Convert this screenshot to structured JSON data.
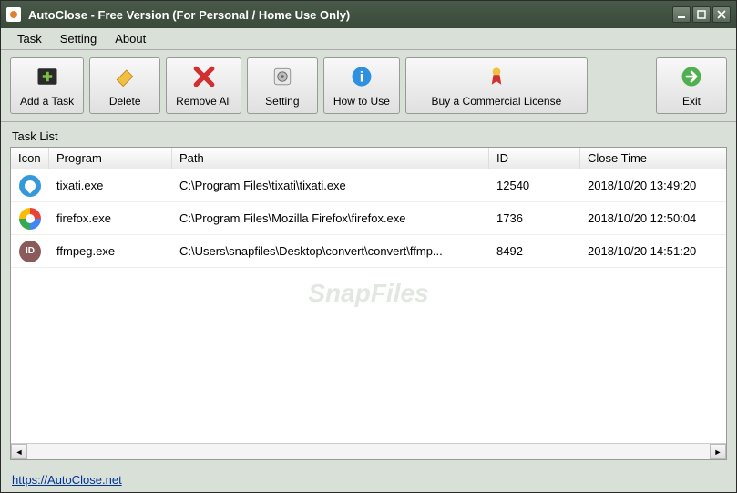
{
  "window": {
    "title": "AutoClose - Free Version (For Personal / Home Use Only)"
  },
  "menu": {
    "task": "Task",
    "setting": "Setting",
    "about": "About"
  },
  "toolbar": {
    "add": "Add a Task",
    "delete": "Delete",
    "removeAll": "Remove All",
    "setting": "Setting",
    "howTo": "How to Use",
    "buy": "Buy a Commercial License",
    "exit": "Exit"
  },
  "list": {
    "label": "Task List",
    "headers": {
      "icon": "Icon",
      "program": "Program",
      "path": "Path",
      "id": "ID",
      "closeTime": "Close Time"
    },
    "rows": [
      {
        "iconClass": "ic-tixati",
        "iconName": "tixati-app-icon",
        "program": "tixati.exe",
        "path": "C:\\Program Files\\tixati\\tixati.exe",
        "id": "12540",
        "closeTime": "2018/10/20 13:49:20"
      },
      {
        "iconClass": "ic-firefox",
        "iconName": "firefox-app-icon",
        "program": "firefox.exe",
        "path": "C:\\Program Files\\Mozilla Firefox\\firefox.exe",
        "id": "1736",
        "closeTime": "2018/10/20 12:50:04"
      },
      {
        "iconClass": "ic-ffmpeg",
        "iconName": "ffmpeg-app-icon",
        "program": "ffmpeg.exe",
        "path": "C:\\Users\\snapfiles\\Desktop\\convert\\convert\\ffmp...",
        "id": "8492",
        "closeTime": "2018/10/20 14:51:20"
      }
    ]
  },
  "watermark": "SnapFiles",
  "footer": {
    "link": "https://AutoClose.net"
  }
}
